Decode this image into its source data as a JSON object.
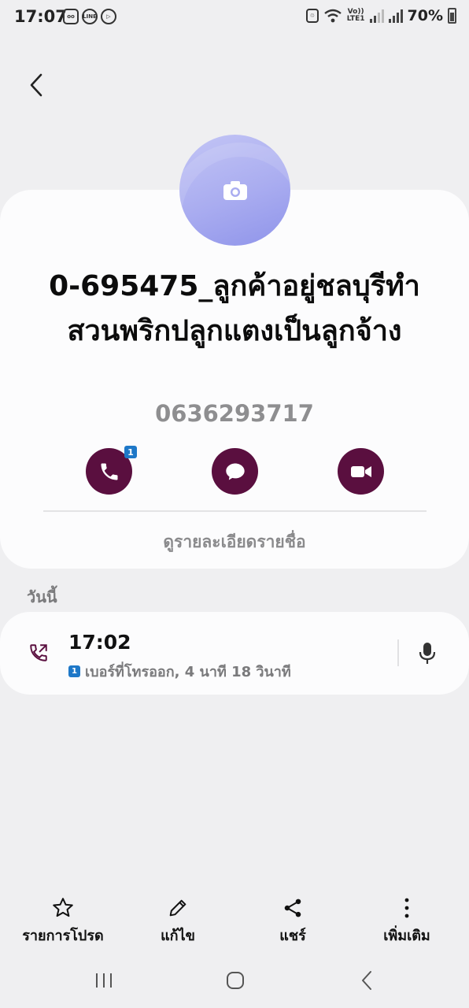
{
  "status_bar": {
    "time": "17:07",
    "battery_percent": "70%",
    "lte_top": "Vo))",
    "lte_bottom": "LTE1",
    "notif_icons": [
      "voicemail-icon",
      "line-app-icon",
      "play-icon"
    ],
    "battery_level": 0.7
  },
  "contact": {
    "name": "0-695475_ลูกค้าอยู่ชลบุรีทำสวนพริกปลูกแตงเป็นลูกจ้าง",
    "number": "0636293717",
    "avatar_color": "#a9acf0"
  },
  "actions": {
    "call_sim_badge": "1",
    "accent": "#5a0f3f",
    "items": [
      "phone-icon",
      "message-icon",
      "video-call-icon"
    ]
  },
  "details_link": "ดูรายละเอียดรายชื่อ",
  "log": {
    "section_label": "วันนี้",
    "entries": [
      {
        "time": "17:02",
        "sim": "1",
        "detail": "เบอร์ที่โทรออก, 4 นาที 18 วินาที",
        "icon": "outgoing-call-icon"
      }
    ]
  },
  "bottom_bar": {
    "favorite": "รายการโปรด",
    "edit": "แก้ไข",
    "share": "แชร์",
    "more": "เพิ่มเติม"
  },
  "colors": {
    "background": "#efeff1",
    "card": "#fcfcfd",
    "sim_blue": "#1e78c8"
  }
}
